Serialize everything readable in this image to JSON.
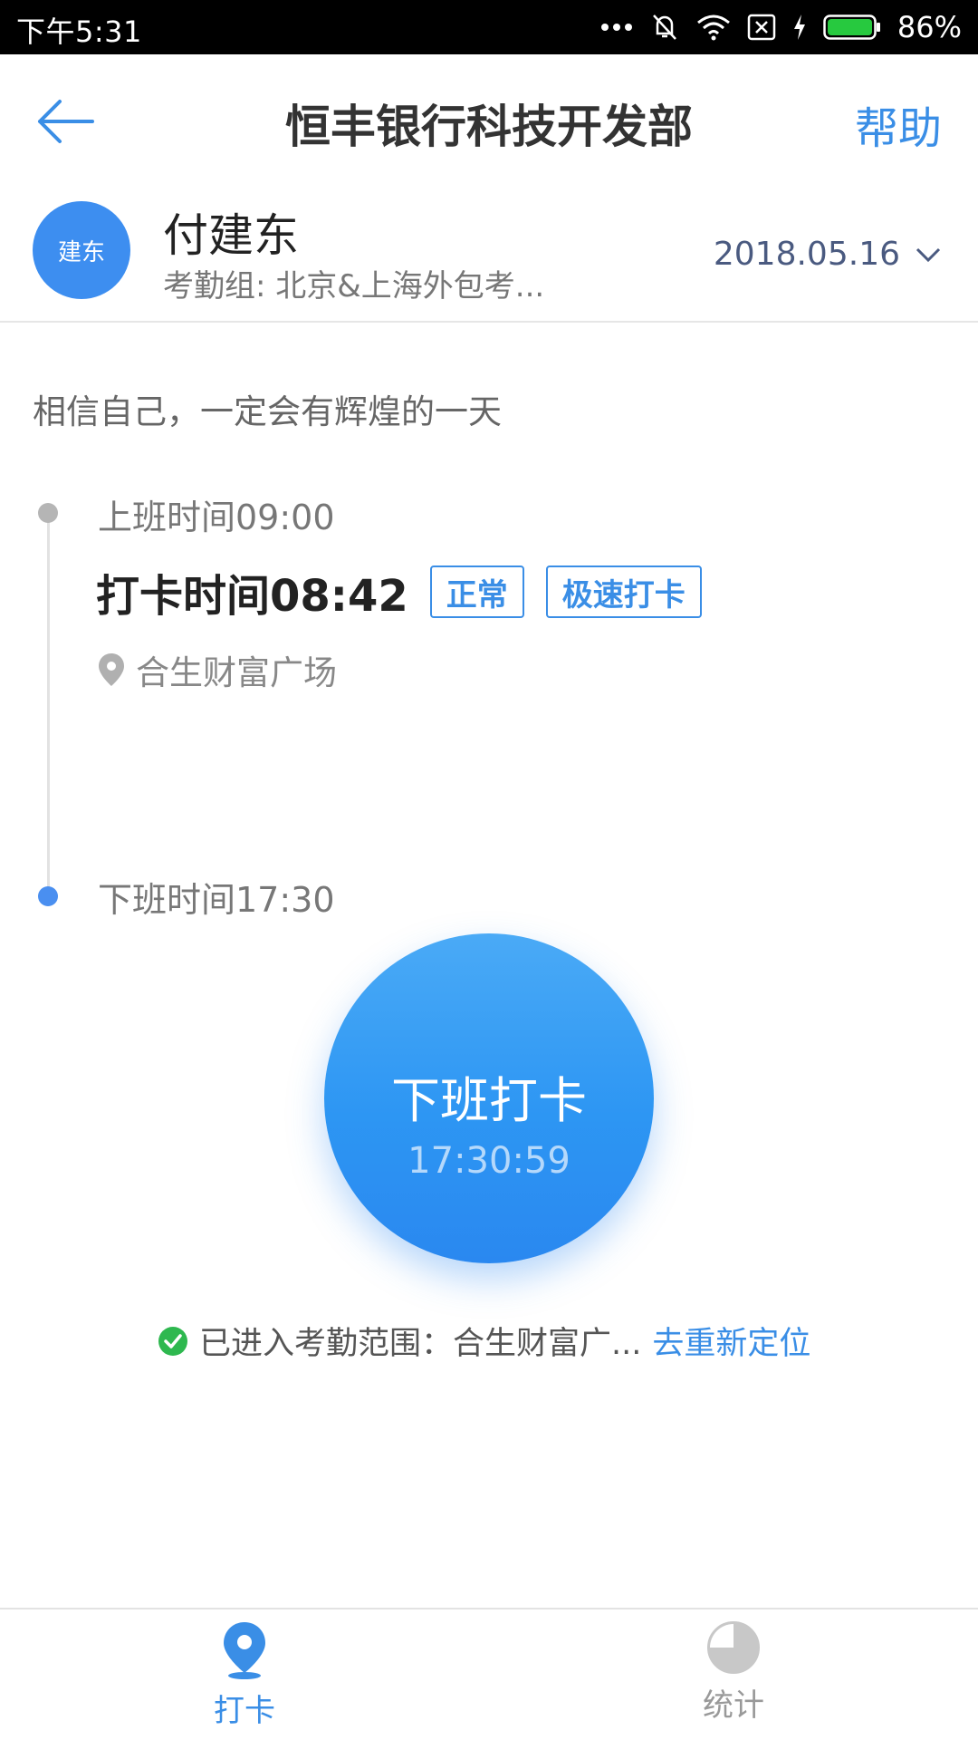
{
  "status_bar": {
    "time": "下午5:31",
    "battery": "86%",
    "icons": [
      "dots-icon",
      "mute-icon",
      "wifi-icon",
      "sim-off-icon",
      "charging-icon",
      "battery-icon"
    ]
  },
  "header": {
    "title": "恒丰银行科技开发部",
    "help": "帮助",
    "back_icon": "arrow-left-icon"
  },
  "user": {
    "avatar_text": "建东",
    "name": "付建东",
    "group": "考勤组: 北京&上海外包考...",
    "date": "2018.05.16"
  },
  "motto": "相信自己，一定会有辉煌的一天",
  "timeline": {
    "work_start": "上班时间09:00",
    "clockin_time": "打卡时间08:42",
    "tags": [
      "正常",
      "极速打卡"
    ],
    "location": "合生财富广场",
    "work_end": "下班时间17:30"
  },
  "clockout_button": {
    "label": "下班打卡",
    "time": "17:30:59"
  },
  "range_notice": {
    "text": "已进入考勤范围：合生财富广...",
    "link": "去重新定位"
  },
  "bottom_nav": {
    "items": [
      {
        "label": "打卡",
        "icon": "location-pin-icon",
        "active": true
      },
      {
        "label": "统计",
        "icon": "pie-chart-icon",
        "active": false
      }
    ]
  },
  "colors": {
    "accent": "#3a8ee6",
    "button_blue": "#2d96f3",
    "success_green": "#2eb84f"
  }
}
